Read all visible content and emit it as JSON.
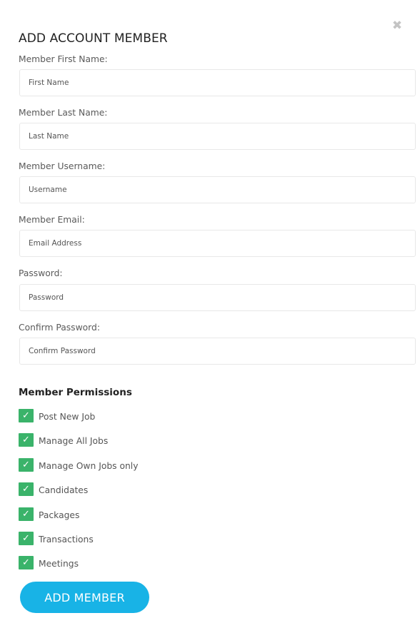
{
  "modal": {
    "title": "ADD ACCOUNT MEMBER",
    "close_icon": "close-icon",
    "close_glyph": "✖"
  },
  "fields": [
    {
      "label": "Member First Name:",
      "placeholder": "First Name",
      "value": ""
    },
    {
      "label": "Member Last Name:",
      "placeholder": "Last Name",
      "value": ""
    },
    {
      "label": "Member Username:",
      "placeholder": "Username",
      "value": ""
    },
    {
      "label": "Member Email:",
      "placeholder": "Email Address",
      "value": ""
    },
    {
      "label": "Password:",
      "placeholder": "Password",
      "value": ""
    },
    {
      "label": "Confirm Password:",
      "placeholder": "Confirm Password",
      "value": ""
    }
  ],
  "permissions": {
    "title": "Member Permissions",
    "check_glyph": "✓",
    "items": [
      {
        "label": "Post New Job",
        "checked": true
      },
      {
        "label": "Manage All Jobs",
        "checked": true
      },
      {
        "label": "Manage Own Jobs only",
        "checked": true
      },
      {
        "label": "Candidates",
        "checked": true
      },
      {
        "label": "Packages",
        "checked": true
      },
      {
        "label": "Transactions",
        "checked": true
      },
      {
        "label": "Meetings",
        "checked": true
      }
    ]
  },
  "actions": {
    "submit_label": "ADD MEMBER"
  },
  "colors": {
    "accent": "#18b3e6",
    "checkbox": "#3ab36a",
    "close": "#c4c4c4"
  }
}
